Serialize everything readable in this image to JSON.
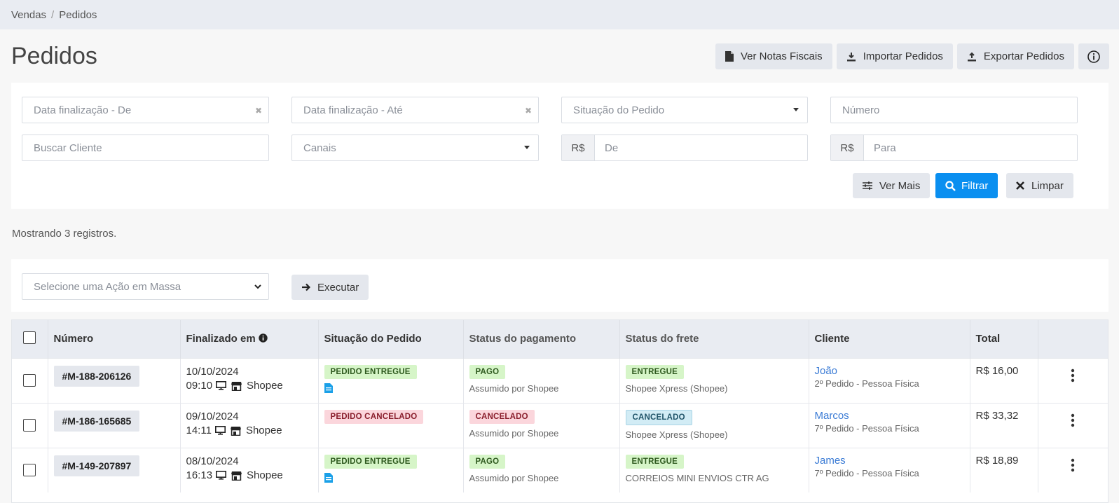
{
  "breadcrumb": {
    "parent": "Vendas",
    "current": "Pedidos"
  },
  "page_title": "Pedidos",
  "top_actions": {
    "notas": "Ver Notas Fiscais",
    "importar": "Importar Pedidos",
    "exportar": "Exportar Pedidos"
  },
  "filters": {
    "date_from_placeholder": "Data finalização - De",
    "date_to_placeholder": "Data finalização - Até",
    "status_placeholder": "Situação do Pedido",
    "number_placeholder": "Número",
    "client_placeholder": "Buscar Cliente",
    "channels_placeholder": "Canais",
    "currency": "R$",
    "value_from_placeholder": "De",
    "value_to_placeholder": "Para",
    "more_label": "Ver Mais",
    "filter_label": "Filtrar",
    "clear_label": "Limpar"
  },
  "records_text": "Mostrando 3 registros.",
  "mass_action": {
    "placeholder": "Selecione uma Ação em Massa",
    "execute_label": "Executar"
  },
  "table": {
    "headers": {
      "number": "Número",
      "finalized": "Finalizado em",
      "situation": "Situação do Pedido",
      "payment": "Status do pagamento",
      "shipping": "Status do frete",
      "client": "Cliente",
      "total": "Total"
    },
    "rows": [
      {
        "number": "#M-188-206126",
        "date": "10/10/2024",
        "time": "09:10",
        "channel": "Shopee",
        "situation": "PEDIDO ENTREGUE",
        "payment": "PAGO",
        "payment_note": "Assumido por Shopee",
        "shipping": "ENTREGUE",
        "shipping_note": "Shopee Xpress (Shopee)",
        "client": "João",
        "client_note": "2º Pedido - Pessoa Física",
        "total": "R$ 16,00"
      },
      {
        "number": "#M-186-165685",
        "date": "09/10/2024",
        "time": "14:11",
        "channel": "Shopee",
        "situation": "PEDIDO CANCELADO",
        "payment": "CANCELADO",
        "payment_note": "Assumido por Shopee",
        "shipping": "CANCELADO",
        "shipping_note": "Shopee Xpress (Shopee)",
        "client": "Marcos",
        "client_note": "7º Pedido - Pessoa Física",
        "total": "R$ 33,32"
      },
      {
        "number": "#M-149-207897",
        "date": "08/10/2024",
        "time": "16:13",
        "channel": "Shopee",
        "situation": "PEDIDO ENTREGUE",
        "payment": "PAGO",
        "payment_note": "Assumido por Shopee",
        "shipping": "ENTREGUE",
        "shipping_note": "CORREIOS MINI ENVIOS CTR AG",
        "client": "James",
        "client_note": "7º Pedido - Pessoa Física",
        "total": "R$ 18,89"
      }
    ]
  },
  "colors": {
    "primary": "#0a8ff0",
    "link": "#3a7bd5",
    "header_bg": "#e9ecf2"
  }
}
